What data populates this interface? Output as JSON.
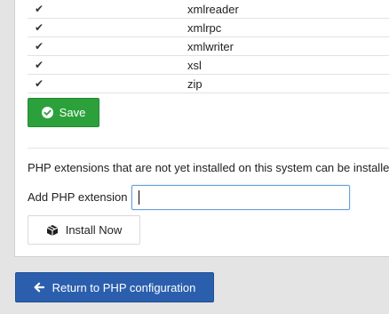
{
  "extensions": [
    {
      "name": "xmlreader",
      "checked": true
    },
    {
      "name": "xmlrpc",
      "checked": true
    },
    {
      "name": "xmlwriter",
      "checked": true
    },
    {
      "name": "xsl",
      "checked": true
    },
    {
      "name": "zip",
      "checked": true
    }
  ],
  "check_glyph": "✔",
  "save_label": "Save",
  "info_text": "PHP extensions that are not yet installed on this system can be installe",
  "add_extension": {
    "label": "Add PHP extension",
    "value": "",
    "placeholder": ""
  },
  "install_label": "Install Now",
  "return_label": "Return to PHP configuration",
  "icons": {
    "save": "check-circle-icon",
    "install": "package-icon",
    "return": "arrow-left-icon"
  },
  "colors": {
    "save_button": "#2ca13b",
    "return_button": "#2b5fae",
    "input_focus_border": "#6aa0d8",
    "page_background": "#e4e4e4"
  }
}
